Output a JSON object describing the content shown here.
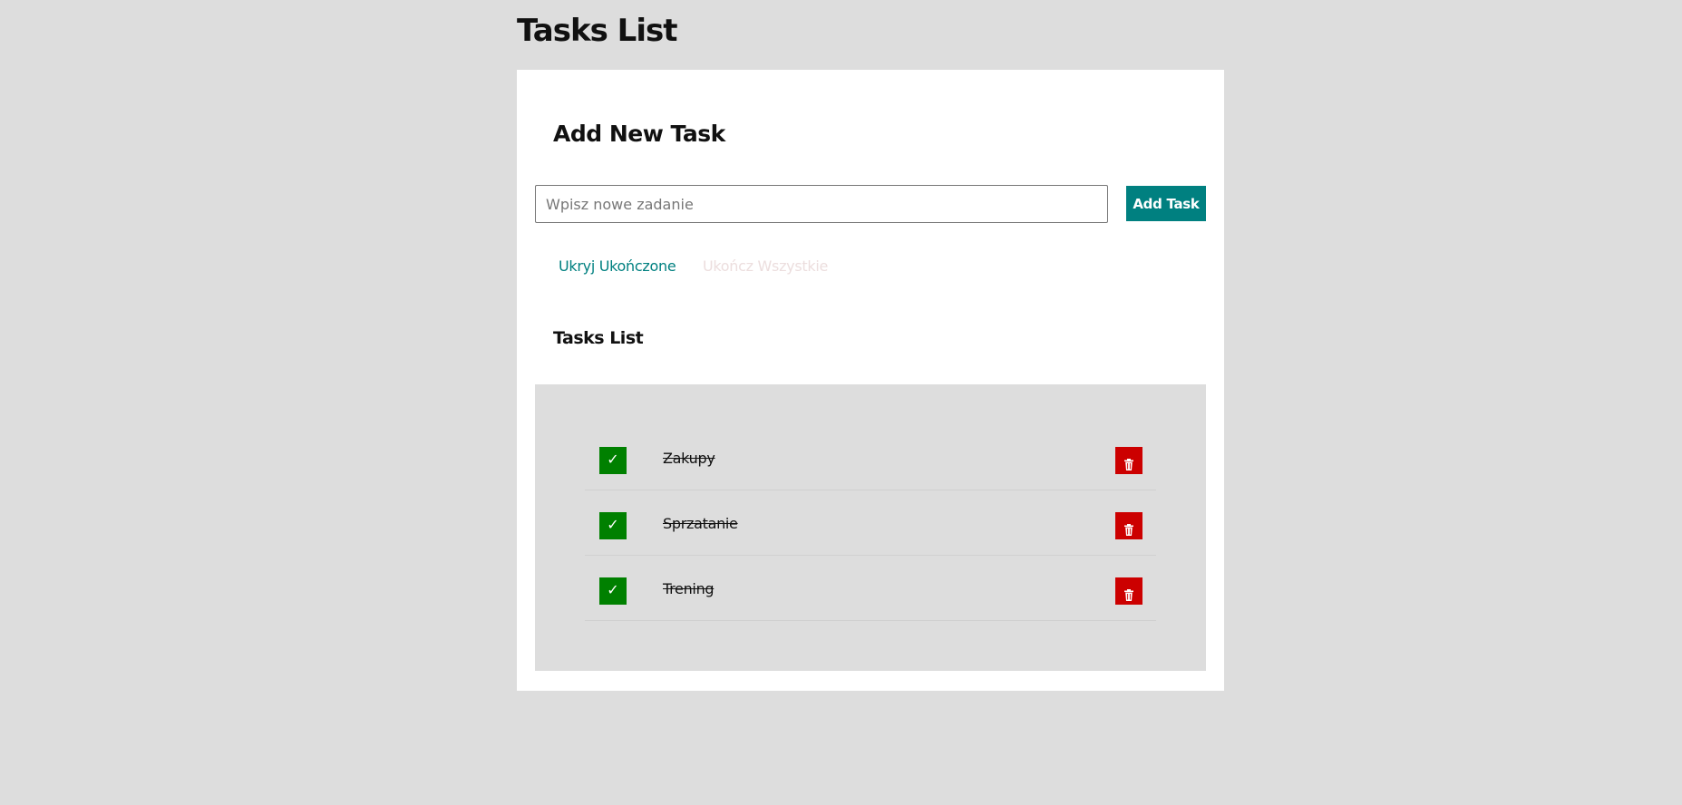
{
  "page": {
    "title": "Tasks List"
  },
  "form": {
    "heading": "Add New Task",
    "input_placeholder": "Wpisz nowe zadanie",
    "input_value": "",
    "add_button_label": "Add Task"
  },
  "actions": {
    "hide_completed_label": "Ukryj Ukończone",
    "complete_all_label": "Ukończ Wszystkie"
  },
  "list": {
    "heading": "Tasks List",
    "tasks": [
      {
        "name": "Zakupy",
        "done": true,
        "done_icon": "✓"
      },
      {
        "name": "Sprzatanie",
        "done": true,
        "done_icon": "✓"
      },
      {
        "name": "Trening",
        "done": true,
        "done_icon": "✓"
      }
    ]
  },
  "icons": {
    "done": "check-icon",
    "delete": "trash-icon"
  },
  "colors": {
    "accent": "#008080",
    "done": "#008000",
    "delete": "#cc0000",
    "background": "#dddddd",
    "disabled_link": "#ecdede"
  }
}
